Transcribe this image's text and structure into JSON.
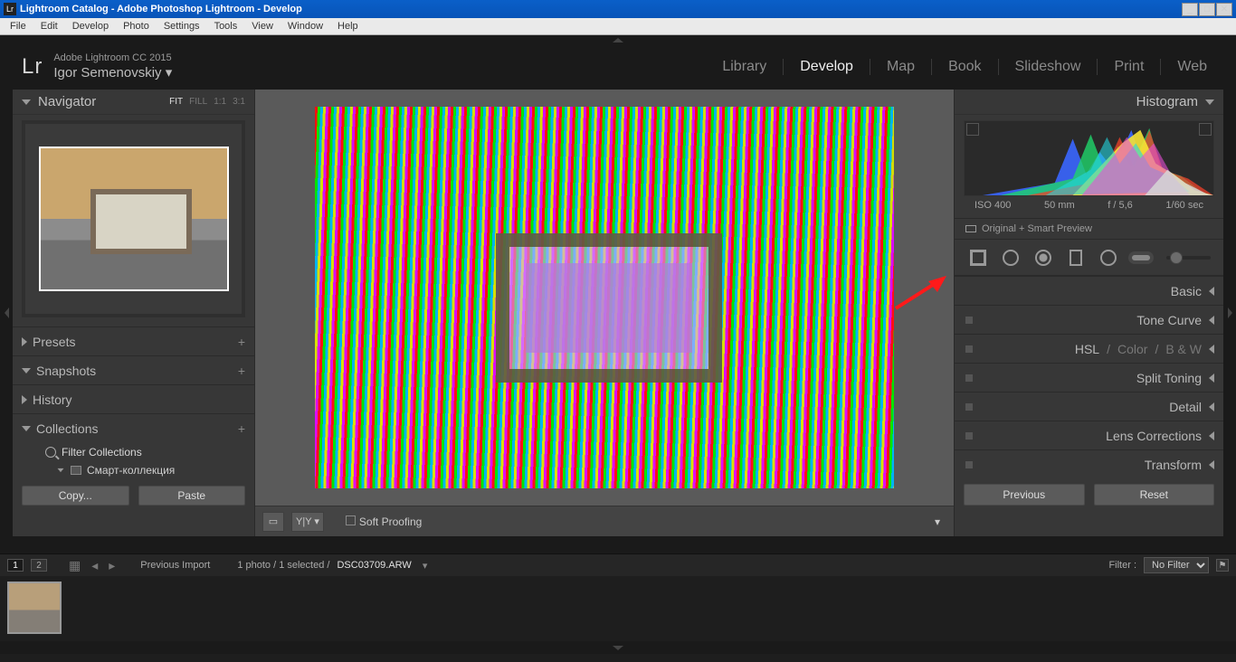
{
  "window": {
    "title": "Lightroom Catalog - Adobe Photoshop Lightroom - Develop"
  },
  "menu": [
    "File",
    "Edit",
    "Develop",
    "Photo",
    "Settings",
    "Tools",
    "View",
    "Window",
    "Help"
  ],
  "identity": {
    "logo": "Lr",
    "product": "Adobe Lightroom CC 2015",
    "user": "Igor Semenovskiy ▾"
  },
  "modules": [
    "Library",
    "Develop",
    "Map",
    "Book",
    "Slideshow",
    "Print",
    "Web"
  ],
  "active_module": "Develop",
  "left": {
    "navigator": {
      "title": "Navigator",
      "zoom_opts": [
        "FIT",
        "FILL",
        "1:1",
        "3:1"
      ],
      "zoom_active": "FIT"
    },
    "presets": "Presets",
    "snapshots": "Snapshots",
    "history": "History",
    "collections": {
      "title": "Collections",
      "filter": "Filter Collections",
      "item": "Смарт-коллекция"
    },
    "copy": "Copy...",
    "paste": "Paste"
  },
  "center": {
    "soft_proof": "Soft Proofing"
  },
  "right": {
    "histogram": {
      "title": "Histogram",
      "iso": "ISO 400",
      "focal": "50 mm",
      "f": "f / 5,6",
      "shutter": "1/60 sec"
    },
    "original": "Original + Smart Preview",
    "basic": "Basic",
    "tone": "Tone Curve",
    "hsl": {
      "hsl": "HSL",
      "color": "Color",
      "bw": "B & W"
    },
    "split": "Split Toning",
    "detail": "Detail",
    "lens": "Lens Corrections",
    "transform": "Transform",
    "previous": "Previous",
    "reset": "Reset"
  },
  "filmstrip": {
    "source": "Previous Import",
    "count": "1 photo / 1 selected /",
    "file": "DSC03709.ARW",
    "filter_label": "Filter :",
    "filter_value": "No Filter",
    "view1": "1",
    "view2": "2"
  }
}
